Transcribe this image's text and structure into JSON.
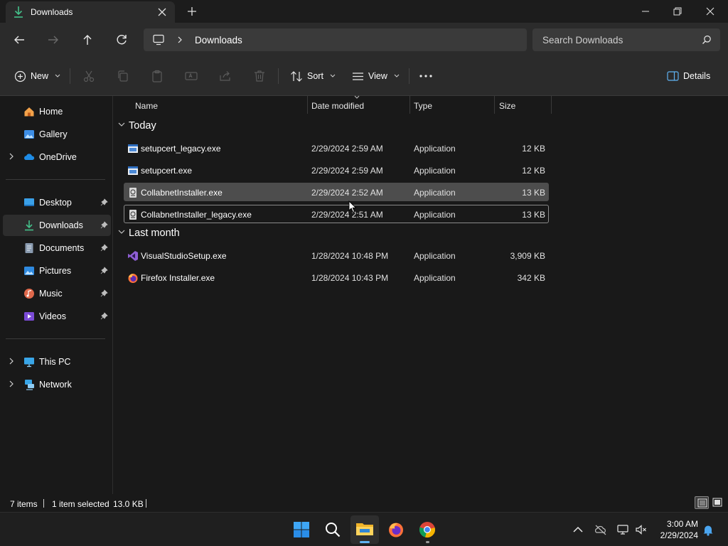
{
  "window": {
    "tab_title": "Downloads",
    "tab_icon": "download-icon"
  },
  "address_bar": {
    "location_icon": "this-pc-icon",
    "breadcrumb": [
      "Downloads"
    ],
    "search_placeholder": "Search Downloads"
  },
  "toolbar": {
    "new_label": "New",
    "sort_label": "Sort",
    "view_label": "View",
    "details_label": "Details",
    "icons": [
      "cut-icon",
      "copy-icon",
      "paste-icon",
      "rename-icon",
      "share-icon",
      "delete-icon",
      "more-icon"
    ]
  },
  "sidebar": {
    "items": [
      {
        "label": "Home",
        "icon": "home-icon"
      },
      {
        "label": "Gallery",
        "icon": "gallery-icon"
      },
      {
        "label": "OneDrive",
        "icon": "onedrive-icon",
        "expandable": true
      },
      {
        "label": "Desktop",
        "icon": "desktop-icon",
        "pinned": true
      },
      {
        "label": "Downloads",
        "icon": "download-icon",
        "pinned": true,
        "active": true
      },
      {
        "label": "Documents",
        "icon": "documents-icon",
        "pinned": true
      },
      {
        "label": "Pictures",
        "icon": "pictures-icon",
        "pinned": true
      },
      {
        "label": "Music",
        "icon": "music-icon",
        "pinned": true
      },
      {
        "label": "Videos",
        "icon": "videos-icon",
        "pinned": true
      },
      {
        "label": "This PC",
        "icon": "this-pc-icon",
        "expandable": true
      },
      {
        "label": "Network",
        "icon": "network-icon",
        "expandable": true
      }
    ]
  },
  "file_list": {
    "columns": [
      "Name",
      "Date modified",
      "Type",
      "Size"
    ],
    "groups": [
      {
        "label": "Today",
        "files": [
          {
            "name": "setupcert_legacy.exe",
            "date": "2/29/2024 2:59 AM",
            "type": "Application",
            "size": "12 KB",
            "icon": "app-window-icon"
          },
          {
            "name": "setupcert.exe",
            "date": "2/29/2024 2:59 AM",
            "type": "Application",
            "size": "12 KB",
            "icon": "app-window-icon"
          },
          {
            "name": "CollabnetInstaller.exe",
            "date": "2/29/2024 2:52 AM",
            "type": "Application",
            "size": "13 KB",
            "icon": "installer-icon",
            "selected": true
          },
          {
            "name": "CollabnetInstaller_legacy.exe",
            "date": "2/29/2024 2:51 AM",
            "type": "Application",
            "size": "13 KB",
            "icon": "installer-icon",
            "focused": true
          }
        ]
      },
      {
        "label": "Last month",
        "files": [
          {
            "name": "VisualStudioSetup.exe",
            "date": "1/28/2024 10:48 PM",
            "type": "Application",
            "size": "3,909 KB",
            "icon": "visual-studio-icon"
          },
          {
            "name": "Firefox Installer.exe",
            "date": "1/28/2024 10:43 PM",
            "type": "Application",
            "size": "342 KB",
            "icon": "firefox-icon"
          }
        ]
      }
    ]
  },
  "status_bar": {
    "item_count": "7 items",
    "selection": "1 item selected",
    "selection_size": "13.0 KB"
  },
  "taskbar": {
    "apps": [
      "start-icon",
      "search-icon",
      "file-explorer-icon",
      "firefox-icon",
      "chrome-icon"
    ],
    "tray": [
      "chevron-up-icon",
      "onedrive-offline-icon",
      "network-icon",
      "volume-muted-icon",
      "notification-icon"
    ],
    "time": "3:00 AM",
    "date": "2/29/2024"
  },
  "colors": {
    "background": "#191919",
    "chrome": "#2b2b2b",
    "selection": "#4d4d4d",
    "accent": "#5fb2f2"
  }
}
